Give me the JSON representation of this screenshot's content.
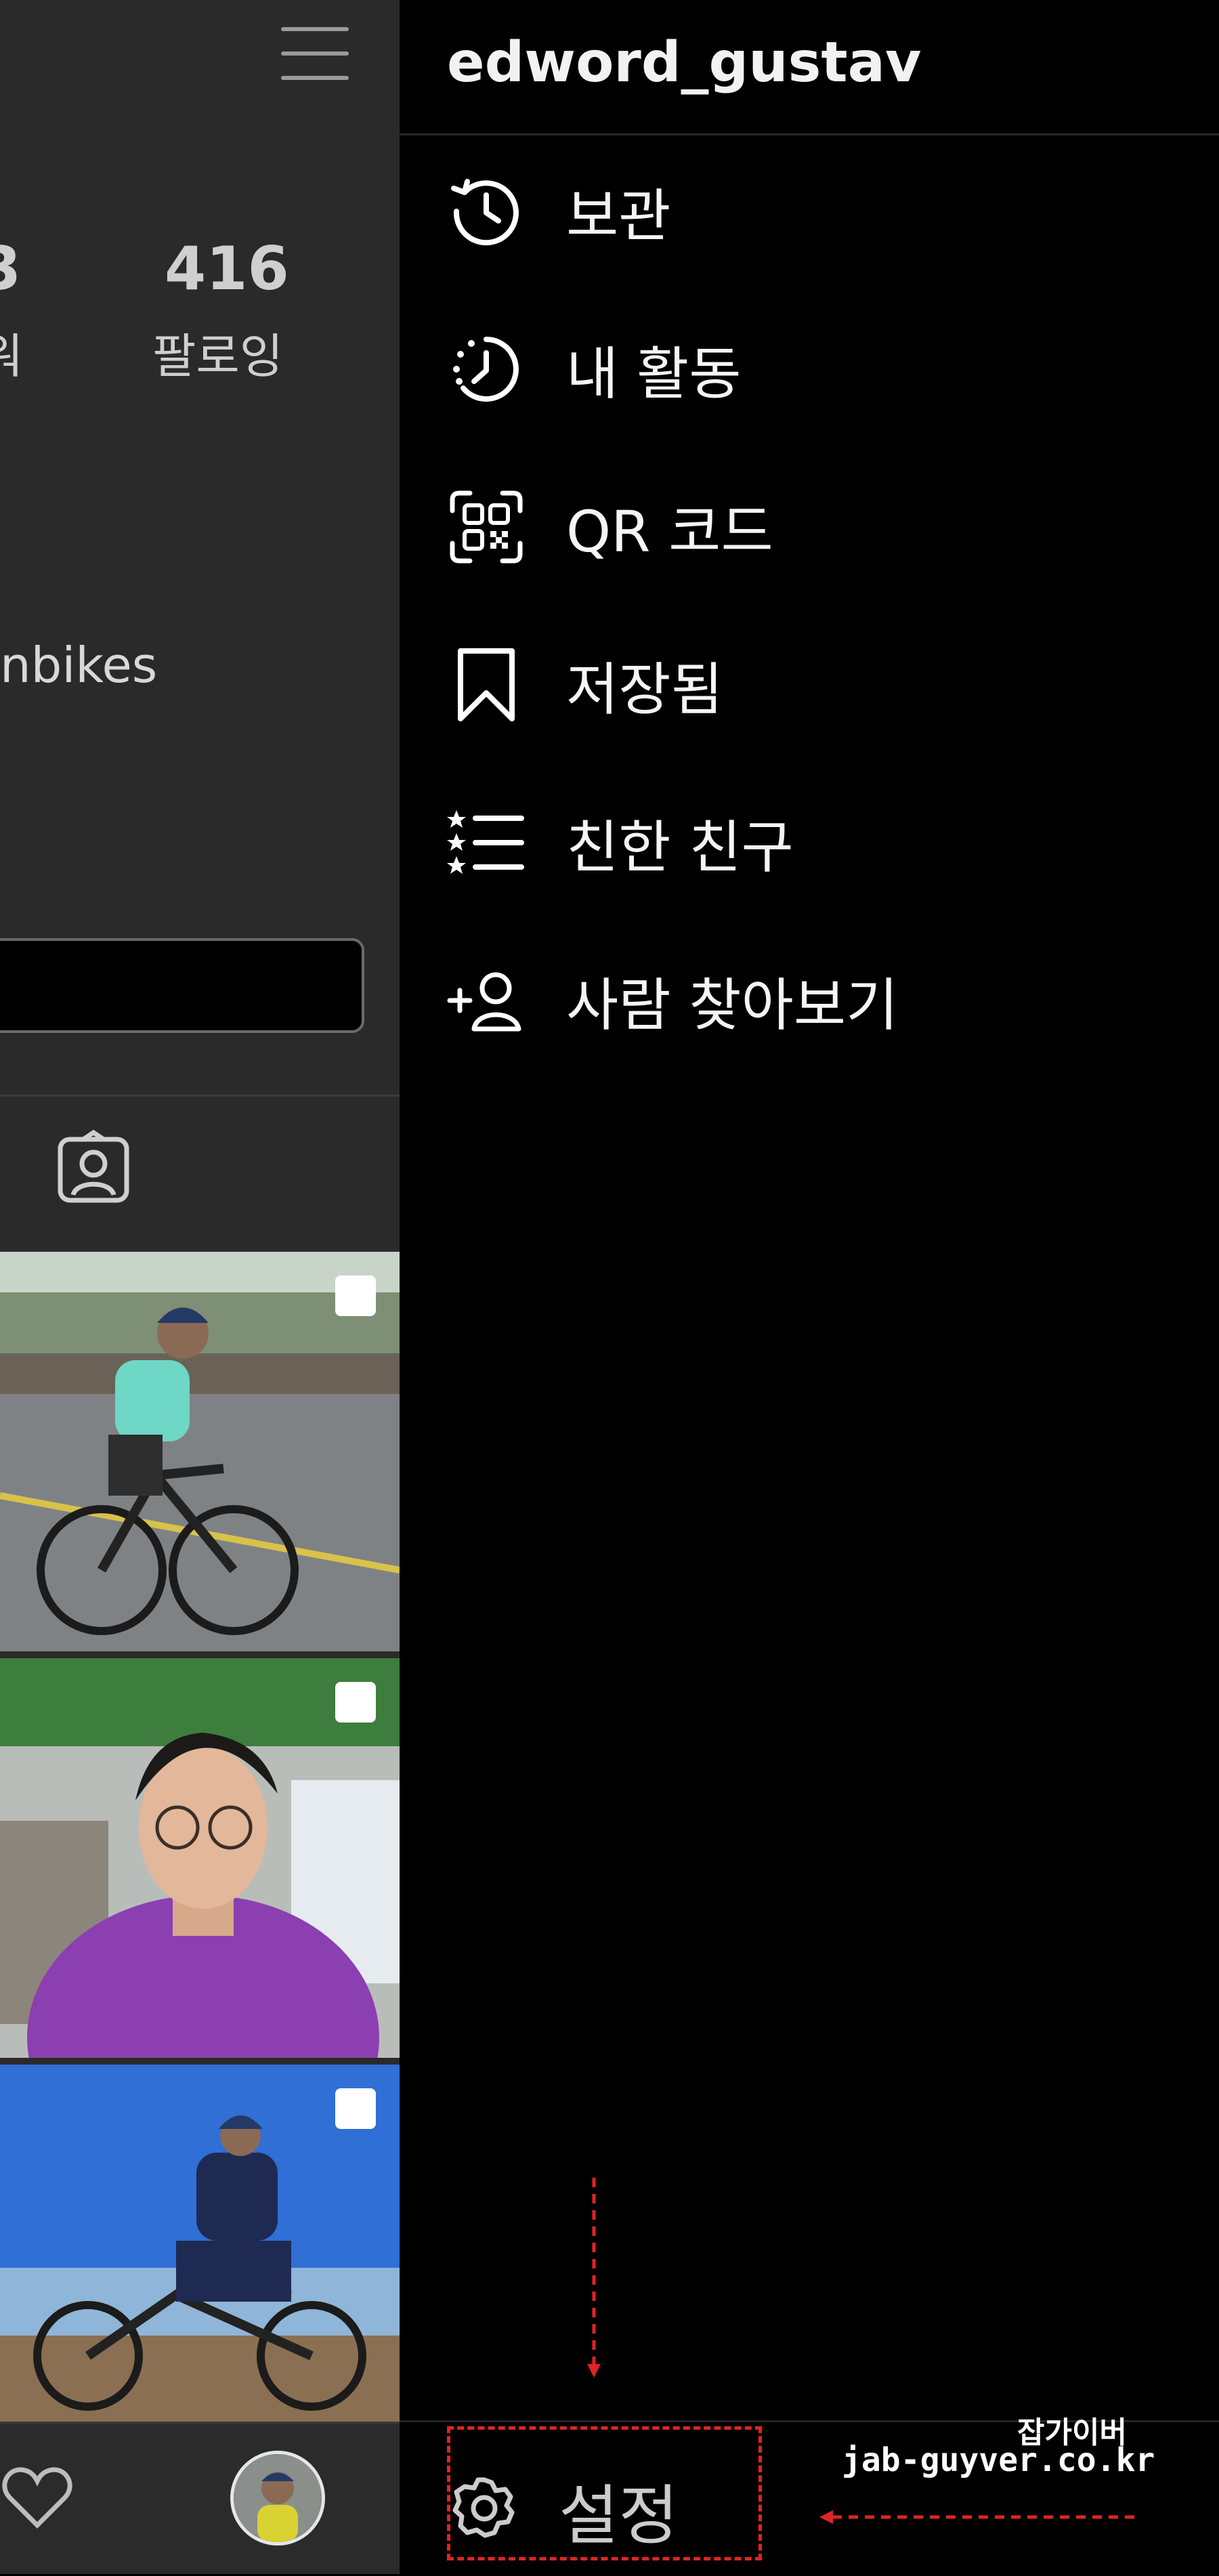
{
  "profile": {
    "menu_icon": "hamburger-icon",
    "followers_count_partial": "3",
    "followers_label_partial": "워",
    "following_count": "416",
    "following_label": "팔로잉",
    "bio_partial": "nbikes",
    "tagged_tab_icon": "person-tag-icon",
    "photos": [
      {
        "desc_icon": "multi-photo-icon"
      },
      {
        "desc_icon": "multi-photo-icon"
      },
      {
        "desc_icon": "multi-photo-icon"
      }
    ]
  },
  "bottom_nav": {
    "heart_icon": "heart-icon",
    "avatar_icon": "profile-avatar-icon"
  },
  "drawer": {
    "username": "edword_gustav",
    "items": [
      {
        "icon": "archive-clock-icon",
        "label": "보관"
      },
      {
        "icon": "activity-icon",
        "label": "내 활동"
      },
      {
        "icon": "qr-code-icon",
        "label": "QR 코드"
      },
      {
        "icon": "bookmark-icon",
        "label": "저장됨"
      },
      {
        "icon": "close-friends-icon",
        "label": "친한 친구"
      },
      {
        "icon": "add-person-icon",
        "label": "사람 찾아보기"
      }
    ],
    "settings": {
      "icon": "gear-icon",
      "label": "설정"
    }
  },
  "watermark": {
    "line1": "잡가이버",
    "line2": "jab-guyver.co.kr"
  },
  "colors": {
    "background": "#000000",
    "annotation": "#e02424"
  }
}
